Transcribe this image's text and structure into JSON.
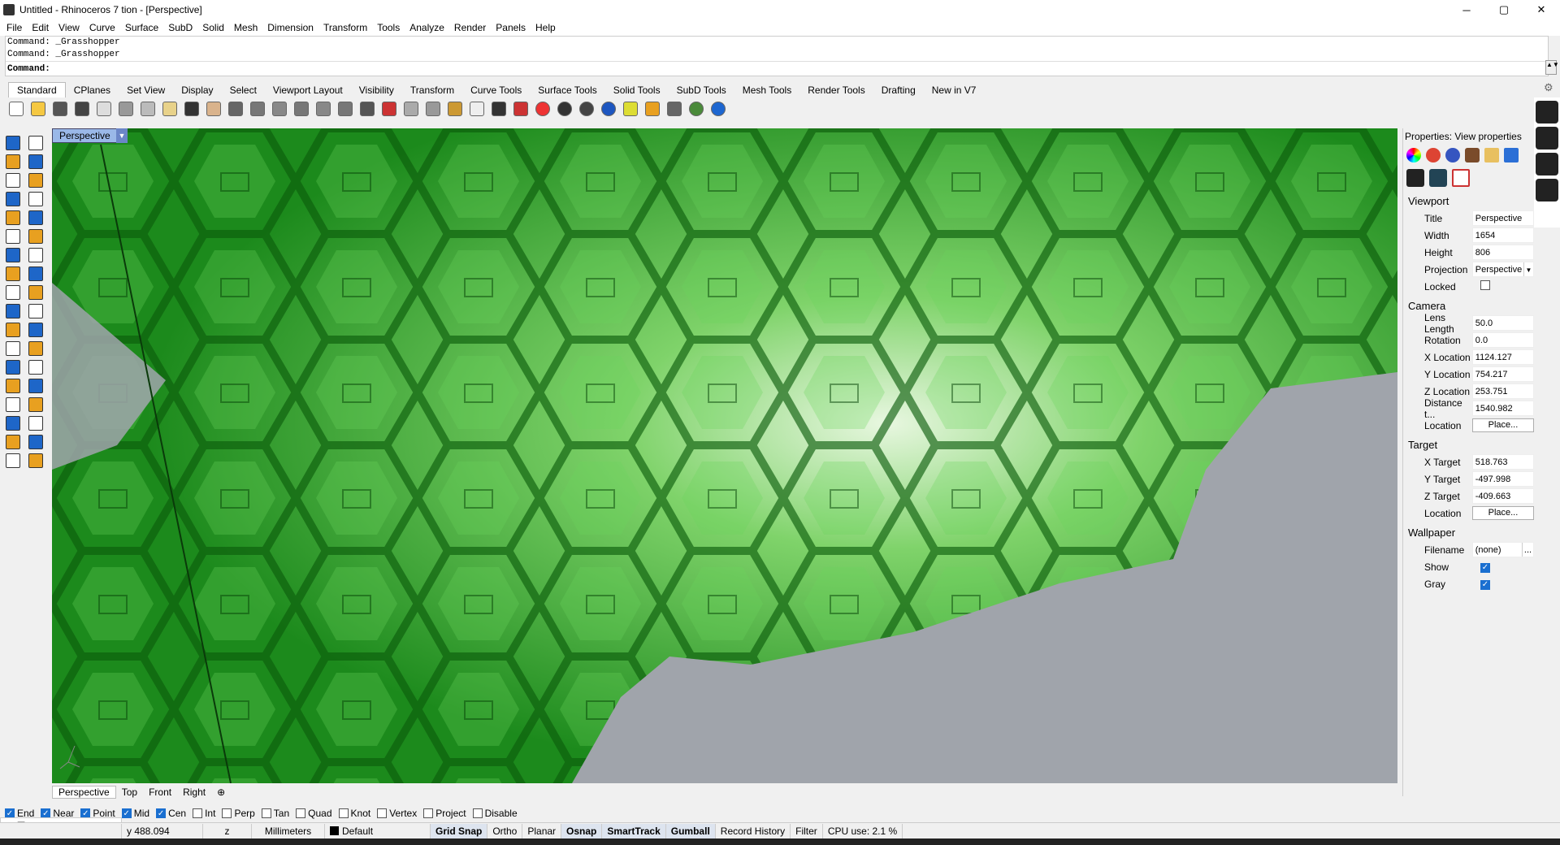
{
  "window": {
    "title": "Untitled - Rhinoceros 7 tion - [Perspective]",
    "min": "─",
    "max": "▢",
    "close": "✕"
  },
  "menu": [
    "File",
    "Edit",
    "View",
    "Curve",
    "Surface",
    "SubD",
    "Solid",
    "Mesh",
    "Dimension",
    "Transform",
    "Tools",
    "Analyze",
    "Render",
    "Panels",
    "Help"
  ],
  "command": {
    "history": [
      "Command: _Grasshopper",
      "Command: _Grasshopper"
    ],
    "prompt": "Command:"
  },
  "toolbar_tabs": [
    "Standard",
    "CPlanes",
    "Set View",
    "Display",
    "Select",
    "Viewport Layout",
    "Visibility",
    "Transform",
    "Curve Tools",
    "Surface Tools",
    "Solid Tools",
    "SubD Tools",
    "Mesh Tools",
    "Render Tools",
    "Drafting",
    "New in V7"
  ],
  "viewport": {
    "label": "Perspective",
    "menu_glyph": "▼",
    "axis_labels": [
      "z",
      "x",
      "y"
    ]
  },
  "viewport_tabs": [
    "Perspective",
    "Top",
    "Front",
    "Right",
    "⊕"
  ],
  "osnaps": [
    {
      "label": "End",
      "on": true
    },
    {
      "label": "Near",
      "on": true
    },
    {
      "label": "Point",
      "on": true
    },
    {
      "label": "Mid",
      "on": true
    },
    {
      "label": "Cen",
      "on": true
    },
    {
      "label": "Int",
      "on": false
    },
    {
      "label": "Perp",
      "on": false
    },
    {
      "label": "Tan",
      "on": false
    },
    {
      "label": "Quad",
      "on": false
    },
    {
      "label": "Knot",
      "on": false
    },
    {
      "label": "Vertex",
      "on": false
    },
    {
      "label": "Project",
      "on": false
    },
    {
      "label": "Disable",
      "on": false
    }
  ],
  "status": {
    "coord_y": "y 488.094",
    "coord_z": "z",
    "units": "Millimeters",
    "layer": "Default",
    "items": [
      "Grid Snap",
      "Ortho",
      "Planar",
      "Osnap",
      "SmartTrack",
      "Gumball",
      "Record History",
      "Filter"
    ],
    "cpu": "CPU use: 2.1 %"
  },
  "properties": {
    "title": "Properties: View properties",
    "viewport_section": "Viewport",
    "viewport_rows": [
      {
        "label": "Title",
        "value": "Perspective"
      },
      {
        "label": "Width",
        "value": "1654"
      },
      {
        "label": "Height",
        "value": "806"
      },
      {
        "label": "Projection",
        "value": "Perspective"
      },
      {
        "label": "Locked",
        "value": ""
      }
    ],
    "camera_section": "Camera",
    "camera_rows": [
      {
        "label": "Lens Length",
        "value": "50.0"
      },
      {
        "label": "Rotation",
        "value": "0.0"
      },
      {
        "label": "X Location",
        "value": "1124.127"
      },
      {
        "label": "Y Location",
        "value": "754.217"
      },
      {
        "label": "Z Location",
        "value": "253.751"
      },
      {
        "label": "Distance t...",
        "value": "1540.982"
      }
    ],
    "place_label": "Place...",
    "location_label": "Location",
    "target_section": "Target",
    "target_rows": [
      {
        "label": "X Target",
        "value": "518.763"
      },
      {
        "label": "Y Target",
        "value": "-497.998"
      },
      {
        "label": "Z Target",
        "value": "-409.663"
      }
    ],
    "wallpaper_section": "Wallpaper",
    "filename_label": "Filename",
    "filename_value": "(none)",
    "ellipsis": "...",
    "show_label": "Show",
    "gray_label": "Gray"
  }
}
